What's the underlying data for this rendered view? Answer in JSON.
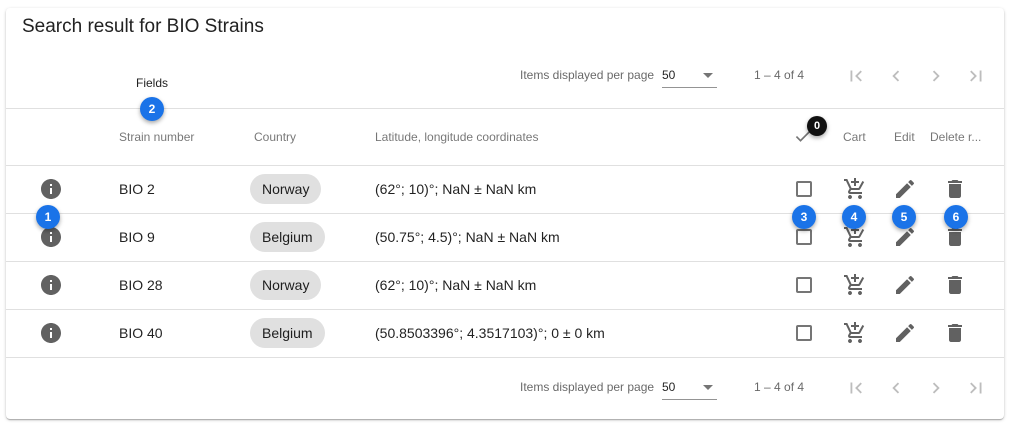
{
  "title": "Search result for BIO Strains",
  "fields_label": "Fields",
  "paginator": {
    "label": "Items displayed per page",
    "page_size": "50",
    "range": "1 – 4 of 4"
  },
  "columns": {
    "strain_number": "Strain number",
    "country": "Country",
    "coordinates": "Latitude, longitude coordinates",
    "cart": "Cart",
    "edit": "Edit",
    "delete": "Delete r..."
  },
  "selected_count": "0",
  "rows": [
    {
      "strain": "BIO 2",
      "country": "Norway",
      "coords": "(62°; 10)°; NaN ± NaN km"
    },
    {
      "strain": "BIO 9",
      "country": "Belgium",
      "coords": "(50.75°; 4.5)°; NaN ± NaN km"
    },
    {
      "strain": "BIO 28",
      "country": "Norway",
      "coords": "(62°; 10)°; NaN ± NaN km"
    },
    {
      "strain": "BIO 40",
      "country": "Belgium",
      "coords": "(50.8503396°; 4.3517103)°; 0 ± 0 km"
    }
  ],
  "callouts": [
    "1",
    "2",
    "3",
    "4",
    "5",
    "6"
  ],
  "colors": {
    "callout": "#1a73e8",
    "chip": "#e0e0e0",
    "icon": "#616161"
  }
}
